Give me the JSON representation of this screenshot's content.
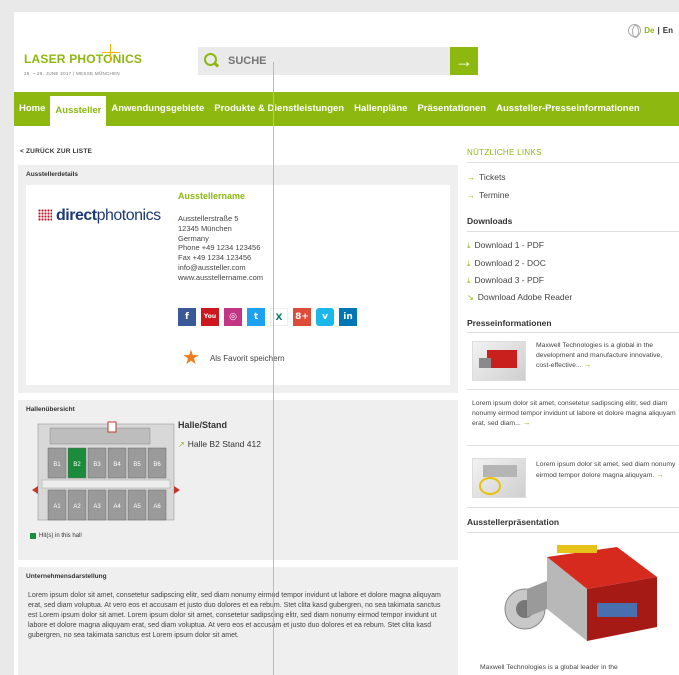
{
  "header": {
    "lang_de": "De",
    "lang_sep": "|",
    "lang_en": "En",
    "logo_title_a": "LASER",
    "logo_title_b": "PHOTONICS",
    "logo_sub": "26. – 29. JUNE 2017 | MESSE MÜNCHEN",
    "search_placeholder": "SUCHE",
    "search_button": "→"
  },
  "nav": {
    "items": [
      "Home",
      "Aussteller",
      "Anwendungsgebiete",
      "Produkte & Dienstleistungen",
      "Hallenpläne",
      "Präsentationen",
      "Aussteller-Presseinformationen"
    ],
    "active": "Aussteller"
  },
  "back_link": "< ZURÜCK ZUR LISTE",
  "exhibitor": {
    "panel_title": "Ausstellerdetails",
    "logo_a": "direct",
    "logo_b": "photonics",
    "name": "Ausstellername",
    "address": [
      "Ausstellerstraße 5",
      "12345 München",
      "Germany",
      "Phone  +49 1234 123456",
      "Fax  +49 1234 123456",
      "info@aussteller.com",
      "www.ausstellername.com"
    ],
    "social": [
      {
        "label": "f",
        "color": "#3b5998"
      },
      {
        "label": "You",
        "color": "#cc181e"
      },
      {
        "label": "◎",
        "color": "#c13584"
      },
      {
        "label": "t",
        "color": "#1da1f2"
      },
      {
        "label": "X",
        "color": "#ffffff"
      },
      {
        "label": "8+",
        "color": "#dd4b39"
      },
      {
        "label": "v",
        "color": "#1ab7ea"
      },
      {
        "label": "in",
        "color": "#0077b5"
      }
    ],
    "favorite": "Als Favorit speichern"
  },
  "hall": {
    "panel_title": "Hallenübersicht",
    "title": "Halle/Stand",
    "stand": "Halle B2 Stand 412",
    "legend": "Hit(s) in this hall",
    "top_row": [
      "B1",
      "B2",
      "B3",
      "B4",
      "B5",
      "B6"
    ],
    "bottom_row": [
      "A1",
      "A2",
      "A3",
      "A4",
      "A5",
      "A6"
    ],
    "highlight": "B2"
  },
  "company": {
    "panel_title": "Unternehmensdarstellung",
    "text": "Lorem ipsum dolor sit amet, consetetur sadipscing elitr, sed diam nonumy eirmod tempor invidunt ut labore et dolore magna aliquyam erat, sed diam voluptua. At vero eos et accusam et justo duo dolores et ea rebum. Stet clita kasd gubergren, no sea takimata sanctus est Lorem ipsum dolor sit amet. Lorem ipsum dolor sit amet, consetetur sadipscing elitr, sed diam nonumy eirmod tempor invidunt ut labore et dolore magna aliquyam erat, sed diam voluptua. At vero eos et accusam et justo duo dolores et ea rebum. Stet clita kasd gubergren, no sea takimata sanctus est Lorem ipsum dolor sit amet."
  },
  "right": {
    "useful_links_title": "NÜTZLICHE LINKS",
    "useful_links": [
      "Tickets",
      "Termine"
    ],
    "downloads_title": "Downloads",
    "downloads": [
      "Download 1 - PDF",
      "Download 2 - DOC",
      "Download 3 - PDF",
      "Download Adobe Reader"
    ],
    "press_title": "Presseinformationen",
    "press_1": "Maxwell Technologies is a global in the development and manufacture innovative, cost-effective...",
    "press_2": "Lorem ipsum dolor sit amet, consetetur sadipscing elitr, sed diam nonumy eirmod tempor invidunt ut labore et dolore magna aliquyam erat, sed diam...",
    "press_3": "Lorem ipsum dolor sit amet, sed diam nonumy eirmod tempor dolore magna aliquyam.",
    "more": "→",
    "presentation_title": "Ausstellerpräsentation",
    "presentation_caption": "Maxwell Technologies is a global leader in the"
  }
}
